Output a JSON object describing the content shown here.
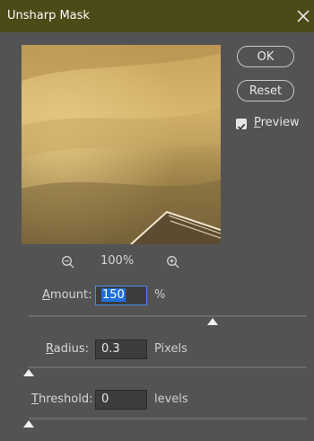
{
  "dialog": {
    "title": "Unsharp Mask"
  },
  "buttons": {
    "ok_label": "OK",
    "reset_label": "Reset"
  },
  "preview": {
    "label_mnemonic": "P",
    "label_rest": "review",
    "checked": true,
    "zoom_level": "100%"
  },
  "amount": {
    "label_mnemonic": "A",
    "label_rest": "mount:",
    "value": "150",
    "unit": "%",
    "slider_fraction": 0.66
  },
  "radius": {
    "label_mnemonic": "R",
    "label_rest": "adius:",
    "value": "0.3",
    "unit": "Pixels",
    "slider_fraction": 0.0
  },
  "threshold": {
    "label_mnemonic": "T",
    "label_rest": "hreshold:",
    "value": "0",
    "unit": "levels",
    "slider_fraction": 0.0
  },
  "colors": {
    "titlebar": "#4c4a16",
    "dialog_bg": "#535353",
    "focus_border": "#4b8be8",
    "selection": "#1e6fd9"
  }
}
